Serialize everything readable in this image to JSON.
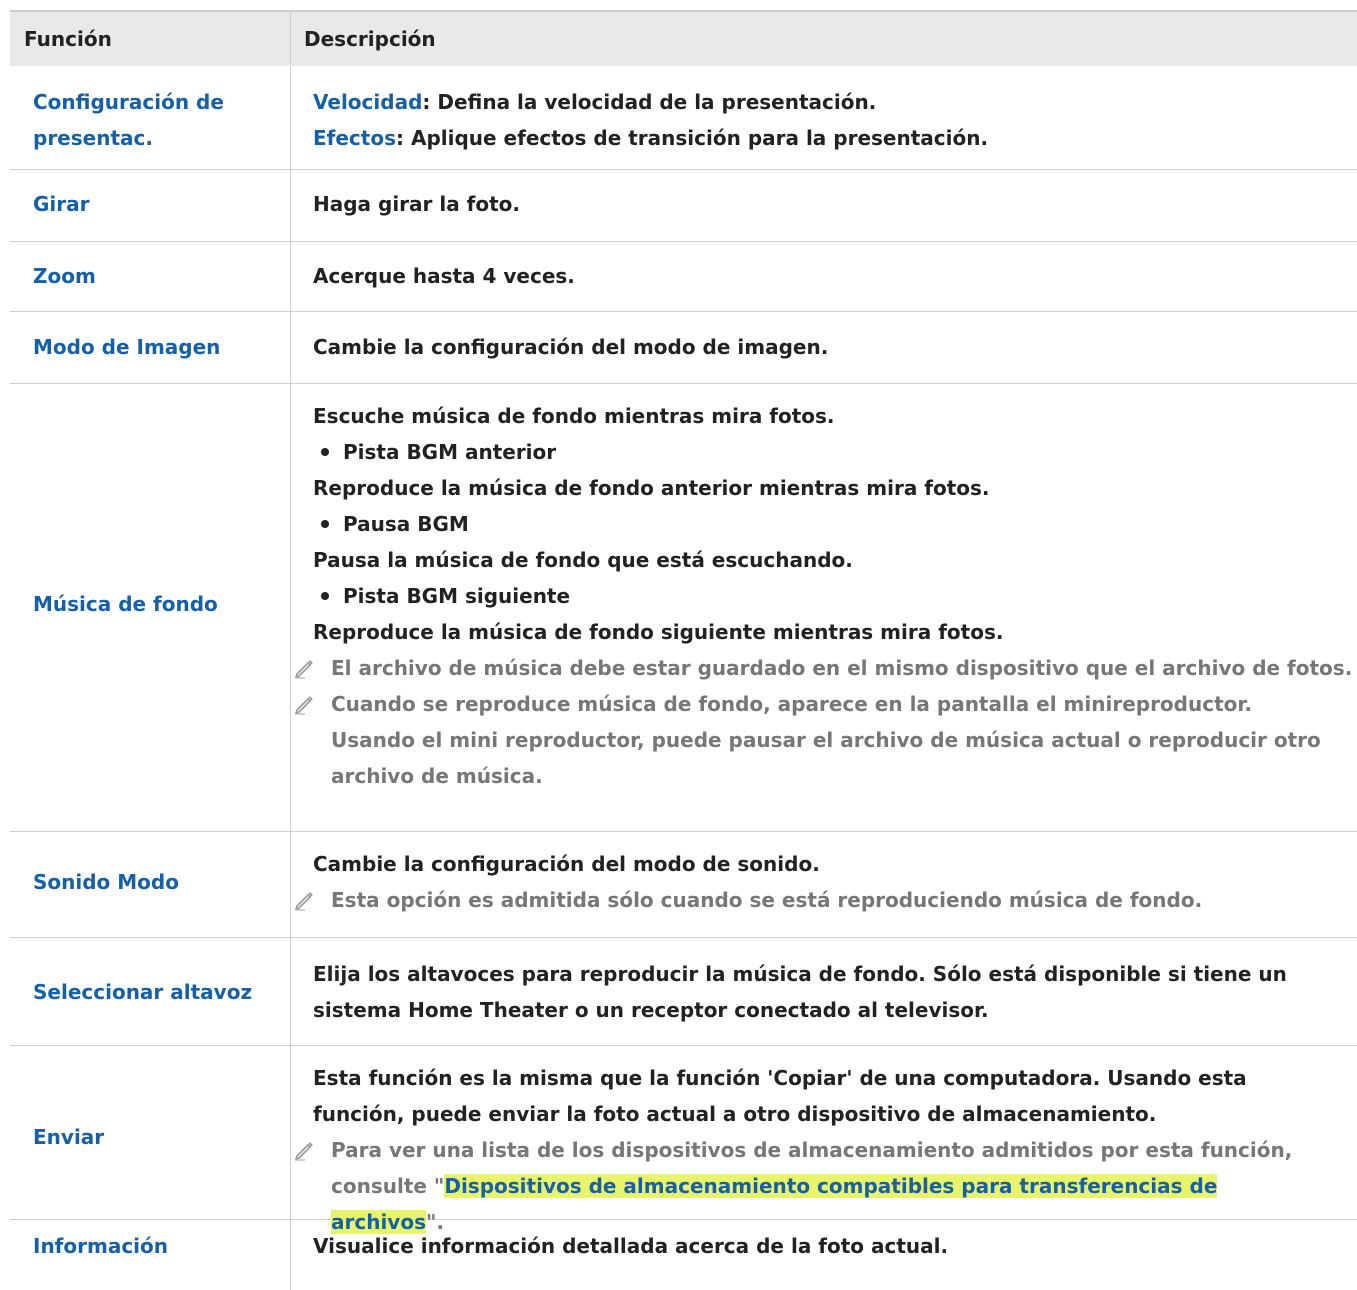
{
  "table": {
    "header": {
      "col_function": "Función",
      "col_description": "Descripción"
    },
    "rows": [
      {
        "function": "Configuración de presentac.",
        "function_lines": [
          "Configuración de",
          "presentac."
        ],
        "items": [
          {
            "keyword": "Velocidad",
            "text": ": Defina la velocidad de la presentación."
          },
          {
            "keyword": "Efectos",
            "text": ": Aplique efectos de transición para la presentación."
          }
        ]
      },
      {
        "function": "Girar",
        "text": "Haga girar la foto."
      },
      {
        "function": "Zoom",
        "text": "Acerque hasta 4 veces."
      },
      {
        "function": "Modo de Imagen",
        "text": "Cambie la configuración del modo de imagen."
      },
      {
        "function": "Música de fondo",
        "intro": "Escuche música de fondo mientras mira fotos.",
        "bullets": [
          {
            "label": "Pista BGM anterior",
            "desc": "Reproduce la música de fondo anterior mientras mira fotos."
          },
          {
            "label": "Pausa BGM",
            "desc": "Pausa la música de fondo que está escuchando."
          },
          {
            "label": "Pista BGM siguiente",
            "desc": "Reproduce la música de fondo siguiente mientras mira fotos."
          }
        ],
        "notes": [
          "El archivo de música debe estar guardado en el mismo dispositivo que el archivo de fotos.",
          "Cuando se reproduce música de fondo, aparece en la pantalla el minireproductor. Usando el mini reproductor, puede pausar el archivo de música actual o reproducir otro archivo de música."
        ]
      },
      {
        "function": "Sonido Modo",
        "text": "Cambie la configuración del modo de sonido.",
        "note": "Esta opción es admitida sólo cuando se está reproduciendo música de fondo."
      },
      {
        "function": "Seleccionar altavoz",
        "text": "Elija los altavoces para reproducir la música de fondo. Sólo está disponible si tiene un sistema Home Theater o un receptor conectado al televisor."
      },
      {
        "function": "Enviar",
        "text": "Esta función es la misma que la función 'Copiar' de una computadora. Usando esta función, puede enviar la foto actual a otro dispositivo de almacenamiento.",
        "note_prefix": "Para ver una lista de los dispositivos de almacenamiento admitidos por esta función, consulte \"",
        "note_link": "Dispositivos de almacenamiento compatibles para transferencias de archivos",
        "note_suffix": "\"."
      },
      {
        "function": "Información",
        "text": "Visualice información detallada acerca de la foto actual."
      }
    ]
  },
  "icons": {
    "note": "pencil-note-icon",
    "bullet": "bullet-dot-icon"
  },
  "colors": {
    "link": "#1660a8",
    "note": "#777777",
    "highlight": "#e8f56b",
    "header_bg": "#e9e9e9",
    "border": "#cfcfcf"
  }
}
